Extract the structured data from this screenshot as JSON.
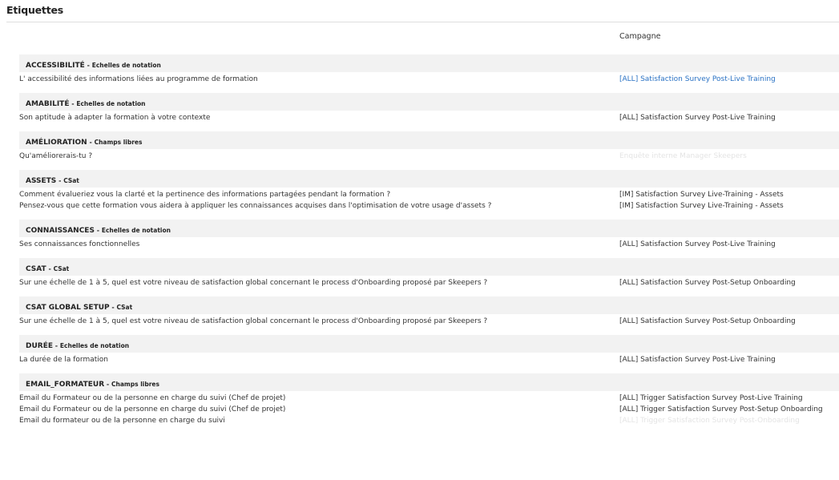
{
  "page": {
    "title": "Etiquettes",
    "campaign_header": "Campagne"
  },
  "groups": [
    {
      "name": "ACCESSIBILITÉ",
      "separator": " - ",
      "type": "Echelles de notation",
      "rows": [
        {
          "question": "L' accessibilité des informations liées au programme de formation",
          "campaign": "[ALL] Satisfaction Survey Post-Live Training",
          "style": "link"
        }
      ]
    },
    {
      "name": "AMABILITÉ",
      "separator": " - ",
      "type": "Echelles de notation",
      "rows": [
        {
          "question": "Son aptitude à adapter la formation à votre contexte",
          "campaign": "[ALL] Satisfaction Survey Post-Live Training",
          "style": "normal"
        }
      ]
    },
    {
      "name": "AMÉLIORATION",
      "separator": " - ",
      "type": "Champs libres",
      "rows": [
        {
          "question": "Qu'améliorerais-tu ?",
          "campaign": "Enquête interne Manager Skeepers",
          "style": "faded"
        }
      ]
    },
    {
      "name": "ASSETS",
      "separator": " - ",
      "type": "CSat",
      "rows": [
        {
          "question": "Comment évalueriez vous la clarté et la pertinence des informations partagées pendant la formation ?",
          "campaign": "[IM] Satisfaction Survey Live-Training - Assets",
          "style": "normal"
        },
        {
          "question": "Pensez-vous que cette formation vous aidera à appliquer les connaissances acquises dans l'optimisation de votre usage d'assets ?",
          "campaign": "[IM] Satisfaction Survey Live-Training - Assets",
          "style": "normal"
        }
      ]
    },
    {
      "name": "CONNAISSANCES",
      "separator": " - ",
      "type": "Echelles de notation",
      "rows": [
        {
          "question": "Ses connaissances fonctionnelles",
          "campaign": "[ALL] Satisfaction Survey Post-Live Training",
          "style": "normal"
        }
      ]
    },
    {
      "name": "CSAT",
      "separator": " - ",
      "type": "CSat",
      "rows": [
        {
          "question": "Sur une échelle de 1 à 5, quel est votre niveau de satisfaction global concernant le process d'Onboarding proposé par Skeepers ?",
          "campaign": "[ALL] Satisfaction Survey Post-Setup Onboarding",
          "style": "normal"
        }
      ]
    },
    {
      "name": "CSAT GLOBAL SETUP",
      "separator": " - ",
      "type": "CSat",
      "rows": [
        {
          "question": "Sur une échelle de 1 à 5, quel est votre niveau de satisfaction global concernant le process d'Onboarding proposé par Skeepers ?",
          "campaign": "[ALL] Satisfaction Survey Post-Setup Onboarding",
          "style": "normal"
        }
      ]
    },
    {
      "name": "DURÉE",
      "separator": " - ",
      "type": "Echelles de notation",
      "rows": [
        {
          "question": "La durée de la formation",
          "campaign": "[ALL] Satisfaction Survey Post-Live Training",
          "style": "normal"
        }
      ]
    },
    {
      "name": "EMAIL_FORMATEUR",
      "separator": " - ",
      "type": "Champs libres",
      "rows": [
        {
          "question": "Email du Formateur ou de la personne en charge du suivi (Chef de projet)",
          "campaign": "[ALL] Trigger Satisfaction Survey Post-Live Training",
          "style": "normal"
        },
        {
          "question": "Email du Formateur ou de la personne en charge du suivi (Chef de projet)",
          "campaign": "[ALL] Trigger Satisfaction Survey Post-Setup Onboarding",
          "style": "normal"
        },
        {
          "question": "Email du formateur ou de la personne en charge du suivi",
          "campaign": "[ALL] Trigger Satisfaction Survey Post-Onboarding",
          "style": "faded"
        }
      ]
    }
  ]
}
